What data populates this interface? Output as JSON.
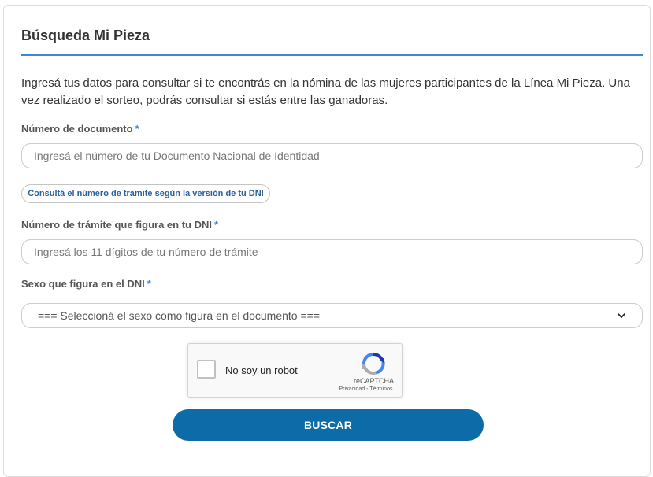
{
  "form": {
    "title": "Búsqueda Mi Pieza",
    "intro": "Ingresá tus datos para consultar si te encontrás en la nómina de las mujeres participantes de la Línea Mi Pieza. Una vez realizado el sorteo, podrás consultar si estás entre las ganadoras.",
    "required_mark": "*",
    "documento": {
      "label": "Número de documento",
      "value": "",
      "placeholder": "Ingresá el número de tu Documento Nacional de Identidad"
    },
    "tramite_help_link": "Consultá el número de trámite según la versión de tu DNI",
    "tramite": {
      "label": "Número de trámite que figura en tu DNI",
      "value": "",
      "placeholder": "Ingresá los 11 dígitos de tu número de trámite"
    },
    "sexo": {
      "label": "Sexo que figura en el DNI",
      "selected": "=== Seleccioná el sexo como figura en el documento ==="
    },
    "captcha": {
      "label": "No soy un robot",
      "brand": "reCAPTCHA",
      "privacy": "Privacidad",
      "separator": " - ",
      "terms": "Términos"
    },
    "submit_label": "BUSCAR"
  },
  "colors": {
    "accent": "#3a88d7",
    "button": "#0d6ba8",
    "link": "#2a5f9a"
  },
  "icons": {
    "select_arrow": "chevron-down-icon",
    "captcha_logo": "recaptcha-logo-icon"
  }
}
